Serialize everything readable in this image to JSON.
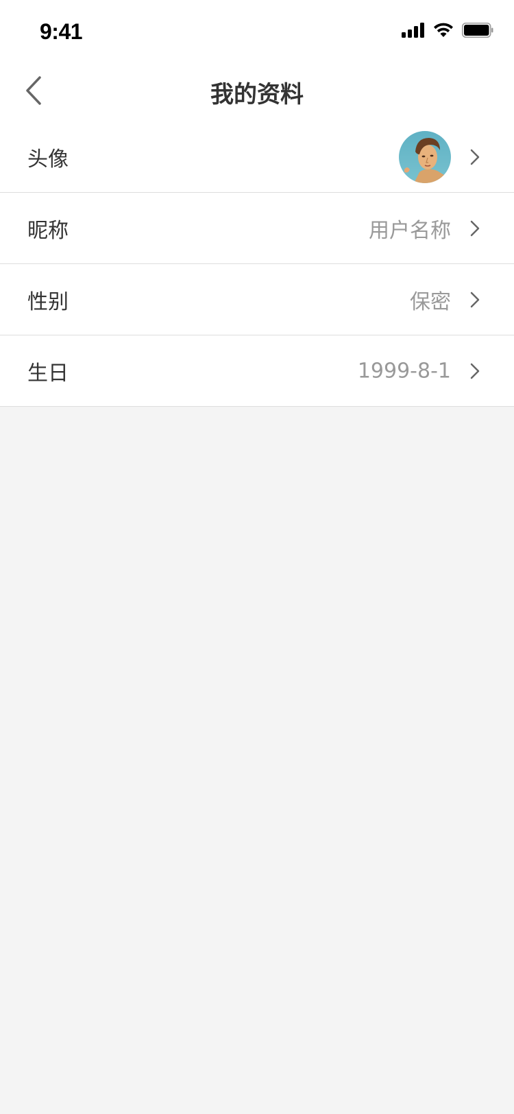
{
  "status_bar": {
    "time": "9:41",
    "icons": [
      "signal-icon",
      "wifi-icon",
      "battery-icon"
    ]
  },
  "header": {
    "title": "我的资料",
    "back_icon": "chevron-left-icon"
  },
  "profile_rows": [
    {
      "label": "头像",
      "type": "avatar",
      "icon": "chevron-right-icon"
    },
    {
      "label": "昵称",
      "value": "用户名称",
      "icon": "chevron-right-icon"
    },
    {
      "label": "性别",
      "value": "保密",
      "icon": "chevron-right-icon"
    },
    {
      "label": "生日",
      "value": "1999-8-1",
      "icon": "chevron-right-icon"
    }
  ],
  "colors": {
    "background": "#f4f4f4",
    "card": "#ffffff",
    "label_text": "#333333",
    "value_text": "#999999",
    "divider": "#dddddd",
    "chevron": "#666666"
  }
}
